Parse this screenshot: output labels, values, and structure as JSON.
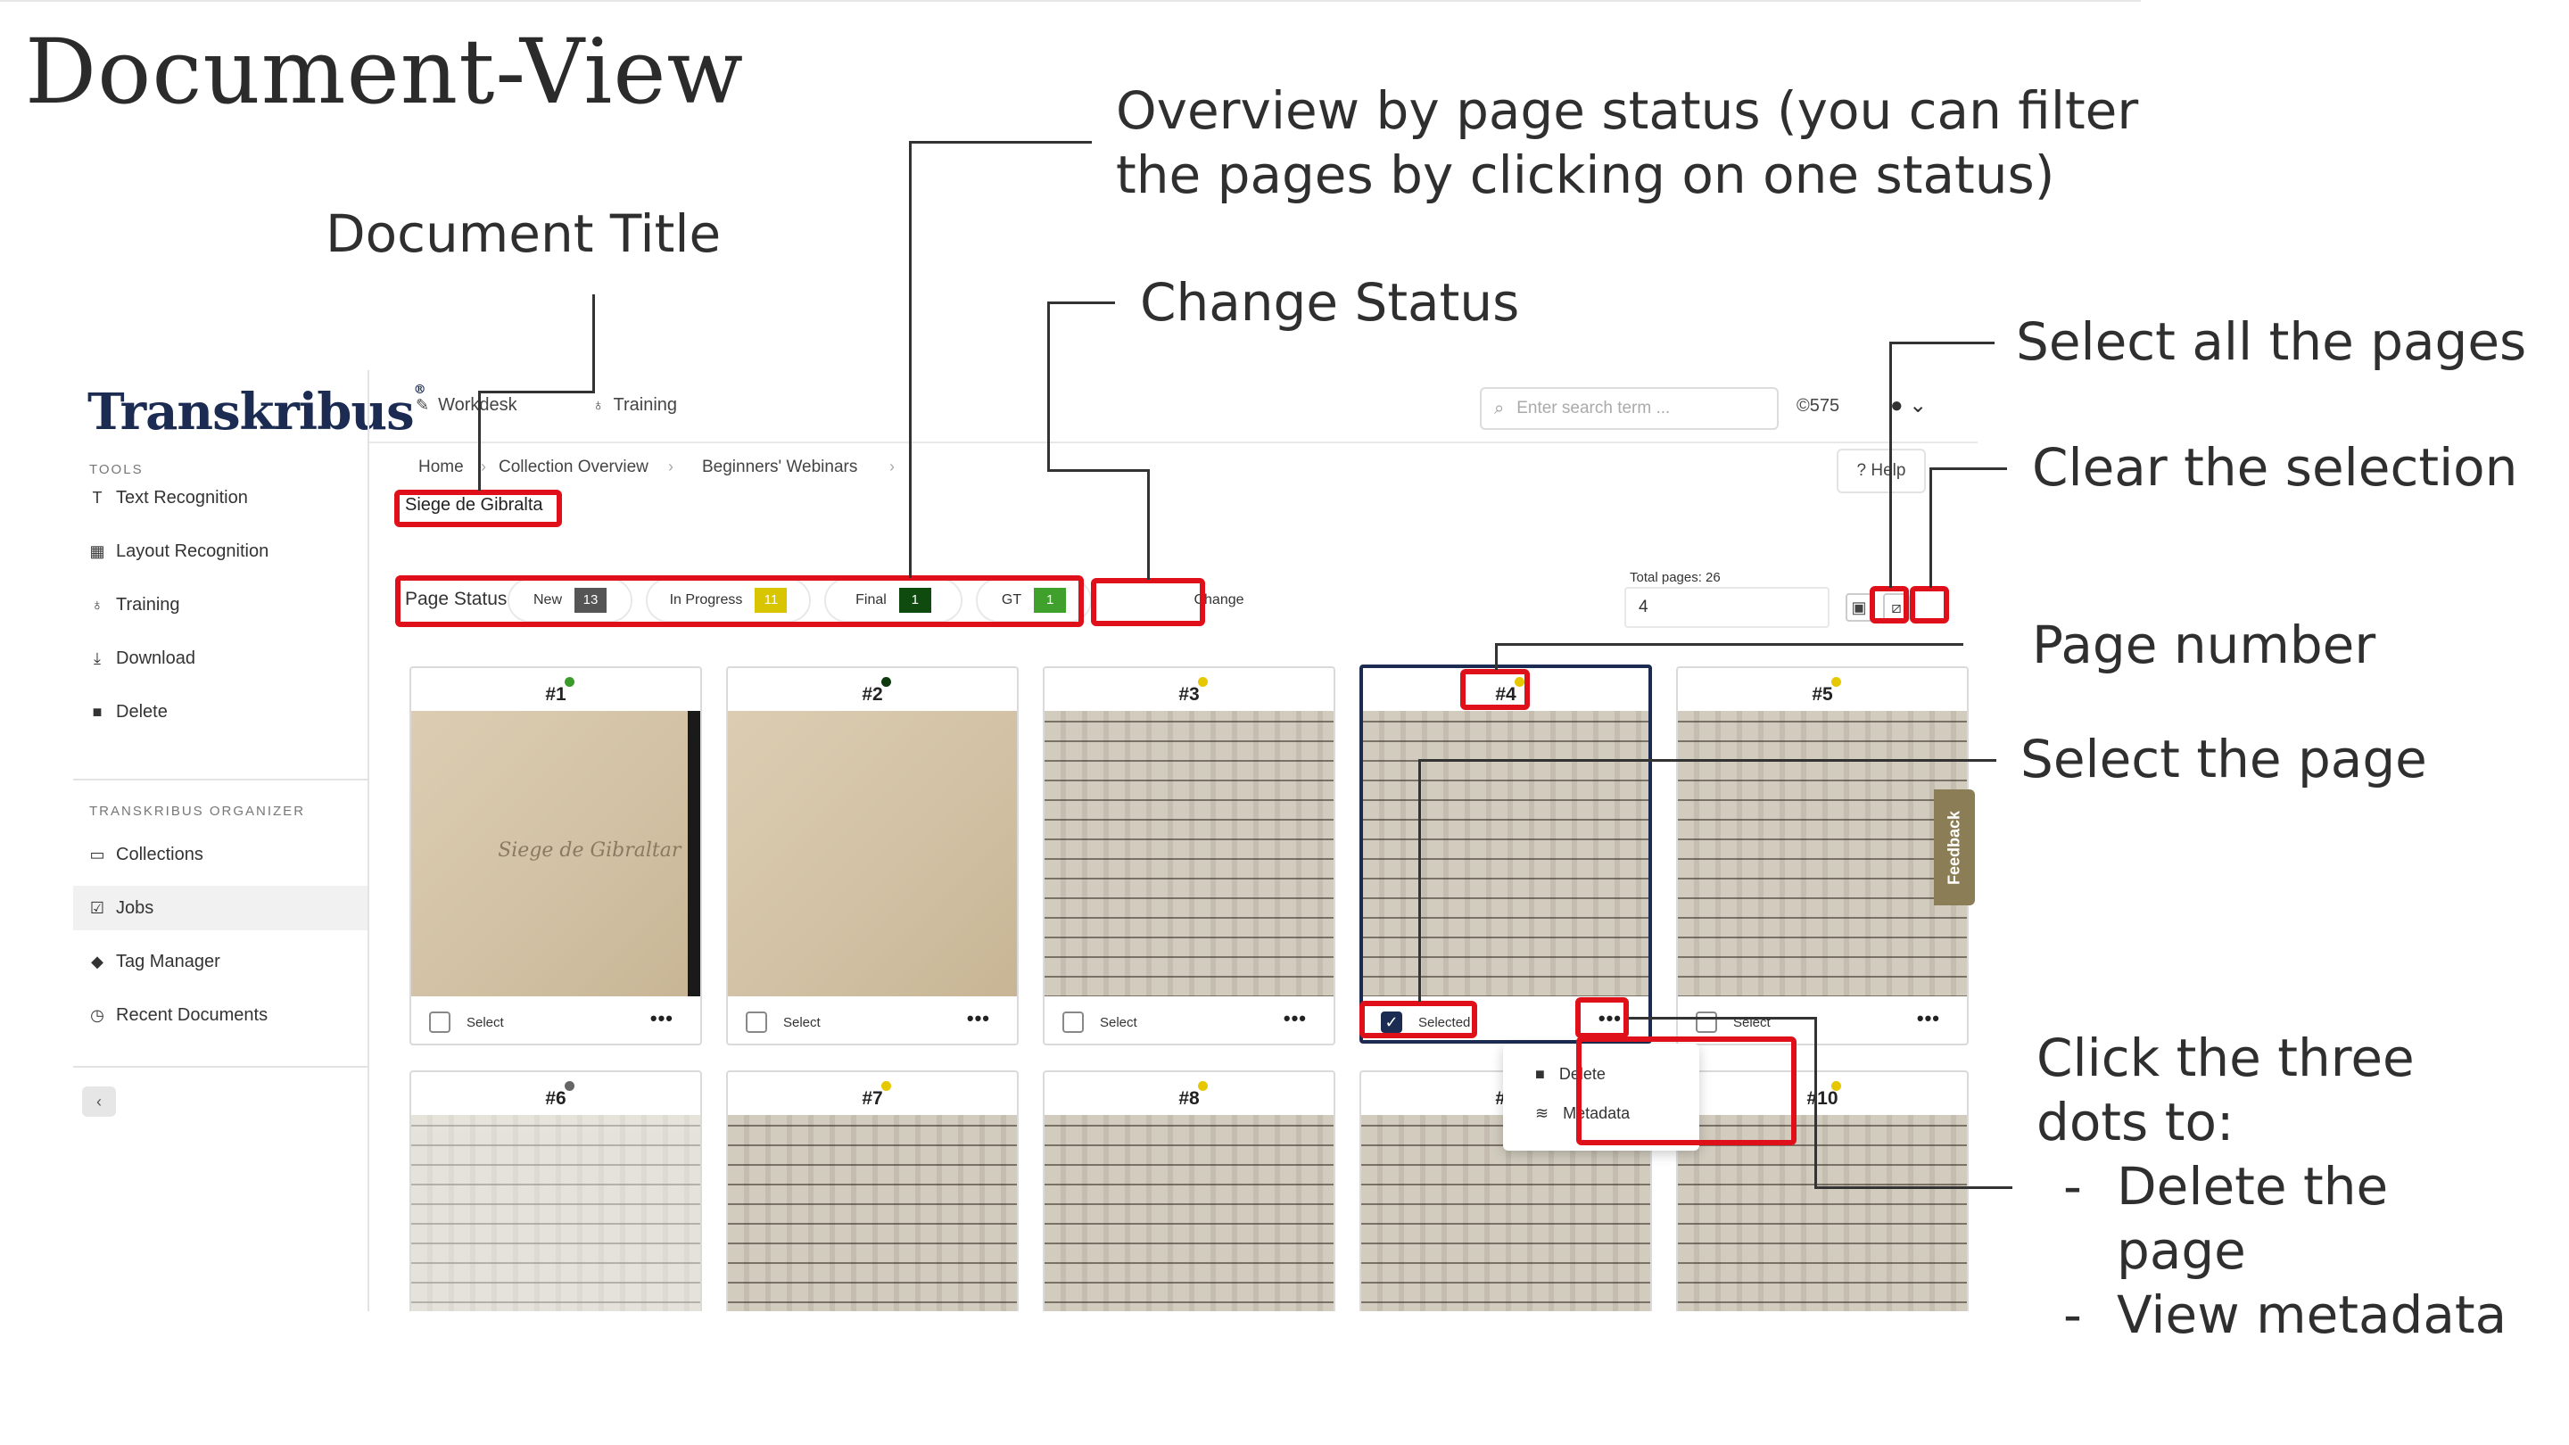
{
  "slide": {
    "title": "Document-View"
  },
  "annotations": {
    "overview": [
      "Overview by page status (you can filter",
      "the pages by clicking on one status)"
    ],
    "doc_title": "Document Title",
    "change_status": "Change Status",
    "select_all": "Select all the pages",
    "clear_selection": "Clear the selection",
    "page_number": "Page number",
    "select_page": "Select the page",
    "three_dots_intro": [
      "Click the three",
      "dots to:"
    ],
    "three_dots_items": [
      "Delete the",
      "View metadata"
    ],
    "three_dots_item_cont": "page"
  },
  "app": {
    "logo": "Transkribus",
    "logo_mark": "®",
    "sidebar": {
      "tools_label": "TOOLS",
      "tools": [
        {
          "label": "Text Recognition",
          "icon": "text-icon"
        },
        {
          "label": "Layout Recognition",
          "icon": "layout-icon"
        },
        {
          "label": "Training",
          "icon": "bulb-icon"
        },
        {
          "label": "Download",
          "icon": "download-icon"
        },
        {
          "label": "Delete",
          "icon": "trash-icon"
        }
      ],
      "organizer_label": "TRANSKRIBUS ORGANIZER",
      "organizer": [
        {
          "label": "Collections",
          "icon": "folder-icon"
        },
        {
          "label": "Jobs",
          "icon": "jobs-icon"
        },
        {
          "label": "Tag Manager",
          "icon": "tag-icon"
        },
        {
          "label": "Recent Documents",
          "icon": "clock-icon"
        }
      ],
      "active": "Jobs"
    },
    "topbar": {
      "nav": [
        {
          "label": "Workdesk",
          "icon": "feather-icon"
        },
        {
          "label": "Training",
          "icon": "bulb-icon"
        }
      ],
      "search_placeholder": "Enter search term ...",
      "credits": "575"
    },
    "breadcrumb": [
      "Home",
      "Collection Overview",
      "Beginners' Webinars"
    ],
    "help_label": "Help",
    "document_title": "Siege de Gibralta",
    "page_status": {
      "label": "Page Status:",
      "items": [
        {
          "label": "New",
          "count": "13",
          "color": "#555555"
        },
        {
          "label": "In Progress",
          "count": "11",
          "color": "#d9c400"
        },
        {
          "label": "Final",
          "count": "1",
          "color": "#0f4a0f"
        },
        {
          "label": "GT",
          "count": "1",
          "color": "#3fa02b"
        }
      ]
    },
    "change_label": "Change",
    "total_pages_label": "Total pages: 26",
    "page_input_value": "4",
    "pages_row1": [
      {
        "num": "#1",
        "select": "Select",
        "dot": "#3a9a2a"
      },
      {
        "num": "#2",
        "select": "Select",
        "dot": "#0f3a0f"
      },
      {
        "num": "#3",
        "select": "Select",
        "dot": "#e6c800"
      },
      {
        "num": "#4",
        "select": "Selected",
        "dot": "#e6c800"
      },
      {
        "num": "#5",
        "select": "Select",
        "dot": "#e6c800"
      }
    ],
    "pages_row2": [
      {
        "num": "#6",
        "dot": "#666666"
      },
      {
        "num": "#7",
        "dot": "#e6c800"
      },
      {
        "num": "#8",
        "dot": "#e6c800"
      },
      {
        "num": "#9",
        "dot": "#e6c800"
      },
      {
        "num": "#10",
        "dot": "#e6c800"
      }
    ],
    "thumb_handwriting_p1": "Siege de Gibraltar",
    "context_menu": [
      {
        "label": "Delete",
        "icon": "trash-icon"
      },
      {
        "label": "Metadata",
        "icon": "database-icon"
      }
    ],
    "feedback_label": "Feedback"
  }
}
